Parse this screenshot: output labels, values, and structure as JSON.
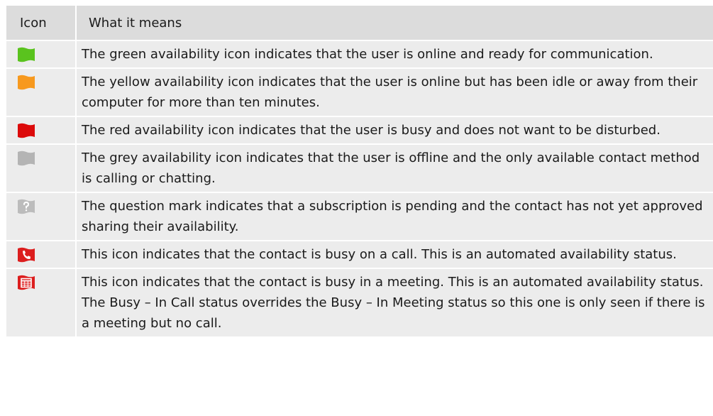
{
  "table": {
    "headers": [
      "Icon",
      "What it means"
    ],
    "rows": [
      {
        "icon": "green-availability-icon",
        "color": "#5ac31e",
        "description": "The green availability icon indicates that the user is online and ready for communication."
      },
      {
        "icon": "yellow-availability-icon",
        "color": "#f7991e",
        "description": "The yellow availability icon indicates that the user is online but has been idle or away from their computer for more than ten minutes."
      },
      {
        "icon": "red-availability-icon",
        "color": "#dc0a0a",
        "description": "The red availability icon indicates that the user is busy and does not want to be disturbed."
      },
      {
        "icon": "grey-availability-icon",
        "color": "#b4b4b4",
        "description": "The grey availability icon indicates that the user is offline and the only available contact method is calling or chatting."
      },
      {
        "icon": "question-mark-icon",
        "color": "#bcbcbc",
        "description": "The question mark indicates that a subscription is pending and the contact has not yet approved sharing their availability."
      },
      {
        "icon": "phone-busy-icon",
        "color": "#dc1e1e",
        "description": "This icon indicates that the contact is busy on a call. This is an automated availability status."
      },
      {
        "icon": "calendar-busy-icon",
        "color": "#dc1e1e",
        "description": "This icon indicates that the contact is busy in a meeting. This is an automated availability status. The Busy – In Call status overrides the Busy – In Meeting status so this one is only seen if there is a meeting but no call."
      }
    ]
  }
}
